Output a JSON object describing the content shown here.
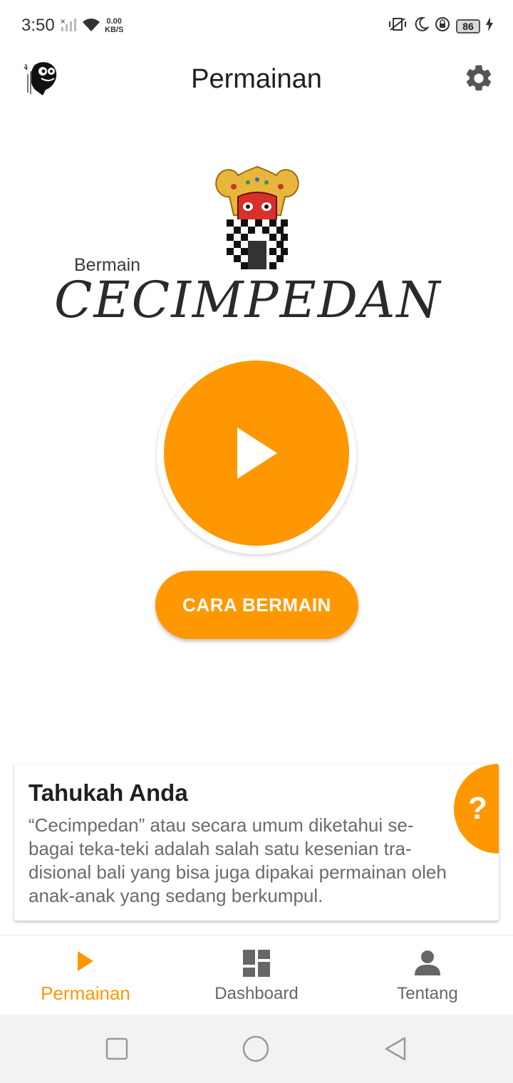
{
  "status_bar": {
    "time": "3:50",
    "speed_value": "0.00",
    "speed_unit": "KB/S",
    "battery": "86"
  },
  "app_bar": {
    "title": "Permainan"
  },
  "hero": {
    "small_label": "Bermain",
    "script_word": "CECIMPEDAN"
  },
  "play_button": {
    "icon": "play-icon"
  },
  "cara_button": {
    "label": "CARA BERMAIN"
  },
  "info_card": {
    "title": "Tahukah Anda",
    "body": "“Cecimpedan” atau secara umum diketahui se-bagai teka-teki adalah salah satu kesenian tra-disional bali yang bisa juga dipakai permainan oleh anak-anak yang sedang berkumpul.",
    "badge": "?"
  },
  "bottom_nav": {
    "items": [
      {
        "label": "Permainan",
        "icon": "play-icon",
        "active": true
      },
      {
        "label": "Dashboard",
        "icon": "dashboard-icon",
        "active": false
      },
      {
        "label": "Tentang",
        "icon": "person-icon",
        "active": false
      }
    ]
  },
  "colors": {
    "accent": "#ff9800",
    "inactive": "#666666"
  }
}
